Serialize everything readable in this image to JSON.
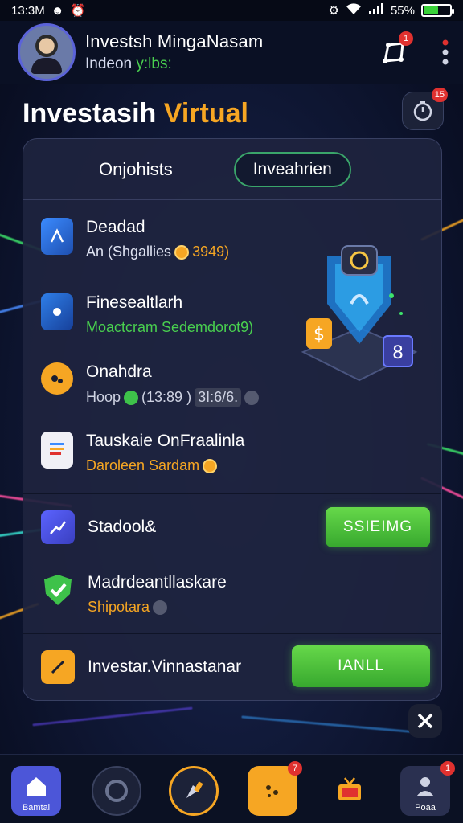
{
  "status_bar": {
    "time": "13:3M",
    "battery_text": "55%",
    "battery_level": 0.55
  },
  "header": {
    "user_name": "Investsh MingaNasam",
    "subtitle_prefix": "Indeon",
    "subtitle_accent": "y:lbs:",
    "notification_badge": "1"
  },
  "title": {
    "main": "Investasih",
    "accent": "Virtual",
    "timer_badge": "15"
  },
  "tabs": {
    "active": "Onjohists",
    "outlined": "Inveahrien"
  },
  "items": [
    {
      "title": "Deadad",
      "sub": "An (Shgallies",
      "value": "3949)"
    },
    {
      "title": "Finesealtlarh",
      "sub": "Moactcram Sedemdorot9)"
    },
    {
      "title": "Onahdra",
      "sub": "Hoop",
      "value1": "(13:89 )",
      "value2": "3I:6/6."
    },
    {
      "title": "Tauskaie OnFraalinla",
      "sub": "Daroleen Sardam"
    }
  ],
  "actions": [
    {
      "title": "Stadool&",
      "button": "SSIEIMG"
    },
    {
      "title": "Madrdeantllaskare",
      "sub": "Shipotara"
    }
  ],
  "footer_action": {
    "title": "Investar.Vinnastanar",
    "button": "IANLL"
  },
  "bottom_nav": [
    {
      "label": "Bamtai",
      "icon": "home-icon"
    },
    {
      "label": "",
      "icon": "gauge-icon"
    },
    {
      "label": "",
      "icon": "brush-icon"
    },
    {
      "label": "",
      "icon": "cookie-icon",
      "badge": "7"
    },
    {
      "label": "",
      "icon": "tv-icon"
    },
    {
      "label": "Poaa",
      "icon": "profile-icon",
      "badge": "1"
    }
  ],
  "colors": {
    "accent_orange": "#f6a623",
    "accent_green": "#49d04f",
    "badge_red": "#e0312f",
    "brand_blue": "#5b63d9"
  }
}
